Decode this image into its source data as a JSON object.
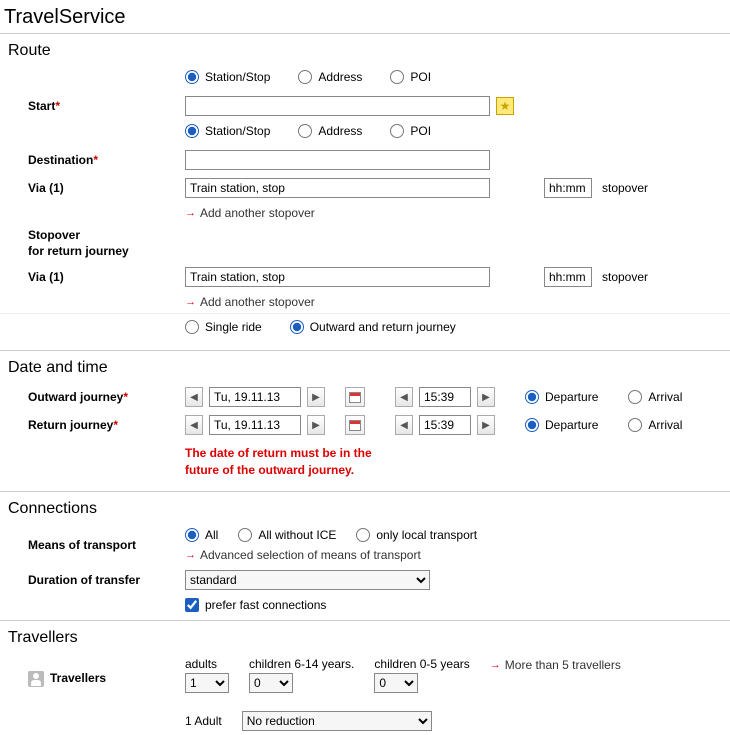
{
  "app_title": "TravelService",
  "route": {
    "heading": "Route",
    "start_label": "Start",
    "dest_label": "Destination",
    "loc_type": {
      "station": "Station/Stop",
      "address": "Address",
      "poi": "POI"
    },
    "via_label": "Via (1)",
    "via_placeholder": "Train station, stop",
    "time_placeholder": "hh:mm",
    "stopover_txt": "stopover",
    "add_stopover": "Add another stopover",
    "stopover_return_label_1": "Stopover",
    "stopover_return_label_2": "for return journey",
    "ride_single": "Single ride",
    "ride_return": "Outward and return journey"
  },
  "datetime": {
    "heading": "Date and time",
    "outward_label": "Outward journey",
    "return_label": "Return journey",
    "date_value": "Tu, 19.11.13",
    "time_value": "15:39",
    "departure": "Departure",
    "arrival": "Arrival",
    "error_l1": "The date of return must be in the",
    "error_l2": "future of the outward journey."
  },
  "connections": {
    "heading": "Connections",
    "mot_label": "Means of transport",
    "dur_label": "Duration of transfer",
    "opt_all": "All",
    "opt_noice": "All without ICE",
    "opt_local": "only local transport",
    "adv_link": "Advanced selection of means of transport",
    "dur_sel": "standard",
    "prefer_fast": "prefer fast connections"
  },
  "travellers": {
    "heading": "Travellers",
    "label": "Travellers",
    "adults": "adults",
    "child614": "children 6-14 years.",
    "child05": "children 0-5 years",
    "more": "More than 5 travellers",
    "adults_val": "1",
    "child614_val": "0",
    "child05_val": "0",
    "summary": "1 Adult",
    "reduction": "No reduction"
  }
}
